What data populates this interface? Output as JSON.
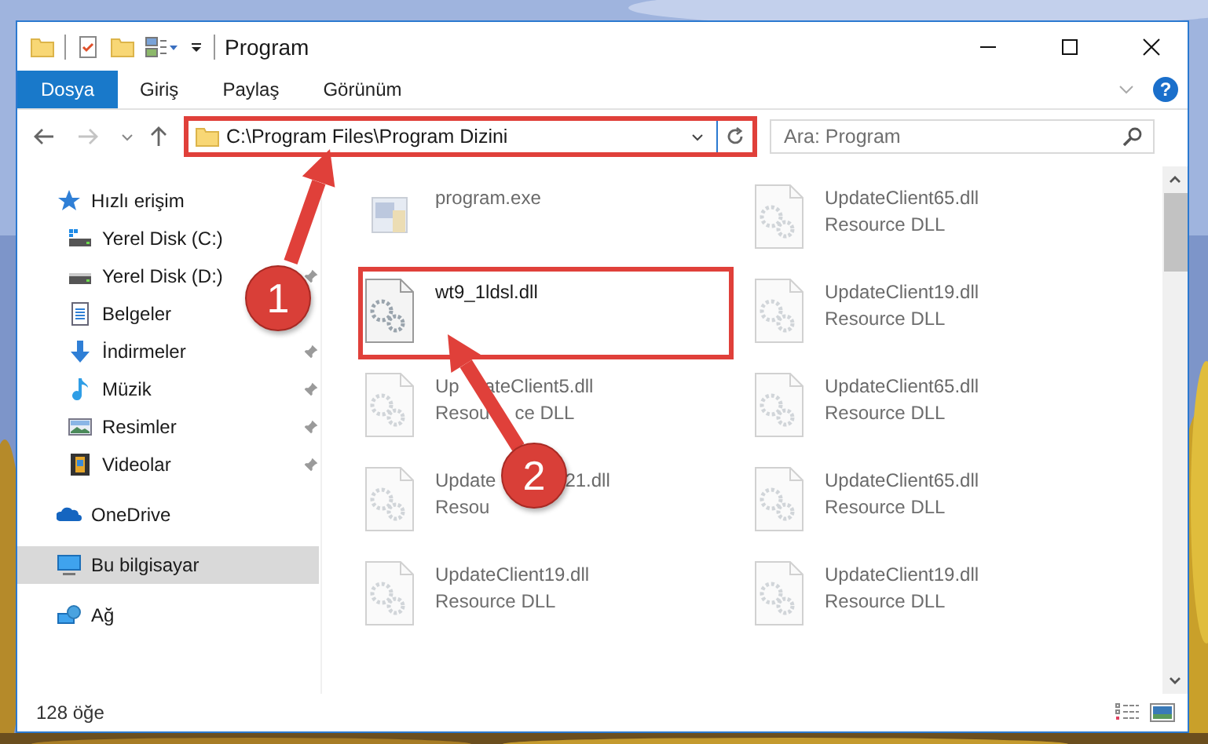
{
  "window": {
    "title": "Program"
  },
  "ribbon_tabs": [
    {
      "label": "Dosya",
      "selected": true
    },
    {
      "label": "Giriş",
      "selected": false
    },
    {
      "label": "Paylaş",
      "selected": false
    },
    {
      "label": "Görünüm",
      "selected": false
    }
  ],
  "help": "?",
  "address": {
    "path": "C:\\Program Files\\Program Dizini"
  },
  "search": {
    "placeholder": "Ara: Program"
  },
  "nav": [
    {
      "label": "Hızlı erişim",
      "selected": false,
      "pinned": false,
      "children": [
        {
          "label": "Yerel Disk (C:)",
          "selected": false,
          "pinned": false
        },
        {
          "label": "Yerel Disk (D:)",
          "selected": false,
          "pinned": true
        },
        {
          "label": "Belgeler",
          "selected": false,
          "pinned": false
        },
        {
          "label": "İndirmeler",
          "selected": false,
          "pinned": true
        },
        {
          "label": "Müzik",
          "selected": false,
          "pinned": true
        },
        {
          "label": "Resimler",
          "selected": false,
          "pinned": true
        },
        {
          "label": "Videolar",
          "selected": false,
          "pinned": true
        }
      ]
    },
    {
      "label": "OneDrive",
      "selected": false,
      "pinned": false
    },
    {
      "label": "Bu bilgisayar",
      "selected": true,
      "pinned": false
    },
    {
      "label": "Ağ",
      "selected": false,
      "pinned": false
    }
  ],
  "files": [
    {
      "name_parts": [
        "program.exe"
      ],
      "kind": "exe",
      "blurred": true
    },
    {
      "name_parts": [
        "UpdateClient65.dll"
      ],
      "type_parts": [
        "Resource DLL"
      ],
      "kind": "dll",
      "blurred": true
    },
    {
      "name_parts": [
        "wt9_1ldsl.dll"
      ],
      "kind": "dll",
      "blurred": false
    },
    {
      "name_parts": [
        "UpdateClient19.dll"
      ],
      "type_parts": [
        "Resource DLL"
      ],
      "kind": "dll",
      "blurred": true
    },
    {
      "name_parts": [
        "Up",
        "ateClient5.dll"
      ],
      "type_parts": [
        "Resou",
        "ce DLL"
      ],
      "kind": "dll",
      "blurred": true
    },
    {
      "name_parts": [
        "UpdateClient65.dll"
      ],
      "type_parts": [
        "Resource DLL"
      ],
      "kind": "dll",
      "blurred": true
    },
    {
      "name_parts": [
        "Update",
        "21.dll"
      ],
      "type_parts": [
        "Resou"
      ],
      "kind": "dll",
      "blurred": true
    },
    {
      "name_parts": [
        "UpdateClient65.dll"
      ],
      "type_parts": [
        "Resource DLL"
      ],
      "kind": "dll",
      "blurred": true
    },
    {
      "name_parts": [
        "UpdateClient19.dll"
      ],
      "type_parts": [
        "Resource DLL"
      ],
      "kind": "dll",
      "blurred": true
    },
    {
      "name_parts": [
        "UpdateClient19.dll"
      ],
      "type_parts": [
        "Resource DLL"
      ],
      "kind": "dll",
      "blurred": true
    }
  ],
  "status_bar": {
    "count": "128 öğe"
  },
  "annotations": [
    {
      "number": "1"
    },
    {
      "number": "2"
    }
  ]
}
